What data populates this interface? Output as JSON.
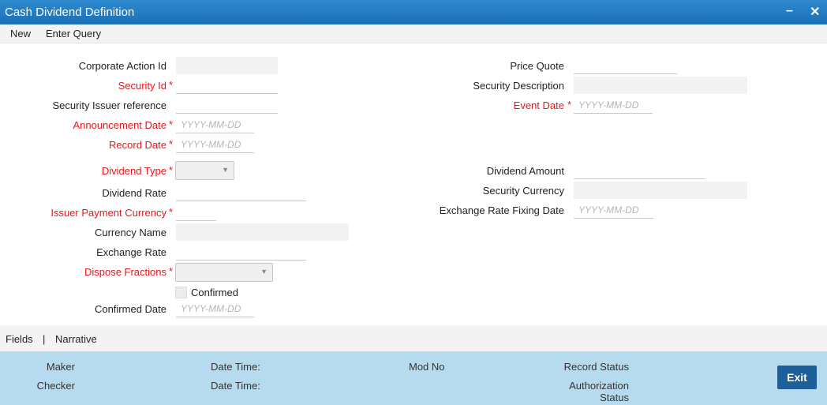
{
  "window": {
    "title": "Cash Dividend Definition",
    "minimize_icon": "minimize-icon",
    "close_icon": "close-icon"
  },
  "menu": {
    "new_label": "New",
    "enter_query_label": "Enter Query"
  },
  "form": {
    "corporate_action_id": {
      "label": "Corporate Action Id",
      "value": ""
    },
    "security_id": {
      "label": "Security Id",
      "value": ""
    },
    "security_issuer_reference": {
      "label": "Security Issuer reference",
      "value": ""
    },
    "announcement_date": {
      "label": "Announcement Date",
      "placeholder": "YYYY-MM-DD"
    },
    "record_date": {
      "label": "Record Date",
      "placeholder": "YYYY-MM-DD"
    },
    "dividend_type": {
      "label": "Dividend Type",
      "selected": ""
    },
    "dividend_rate": {
      "label": "Dividend Rate",
      "value": ""
    },
    "issuer_payment_currency": {
      "label": "Issuer Payment Currency",
      "value": ""
    },
    "currency_name": {
      "label": "Currency Name",
      "value": ""
    },
    "exchange_rate": {
      "label": "Exchange Rate",
      "value": ""
    },
    "dispose_fractions": {
      "label": "Dispose Fractions",
      "selected": ""
    },
    "confirmed": {
      "label": "Confirmed",
      "checked": false
    },
    "confirmed_date": {
      "label": "Confirmed Date",
      "placeholder": "YYYY-MM-DD"
    },
    "price_quote": {
      "label": "Price Quote",
      "value": ""
    },
    "security_description": {
      "label": "Security Description",
      "value": ""
    },
    "event_date": {
      "label": "Event Date",
      "placeholder": "YYYY-MM-DD"
    },
    "dividend_amount": {
      "label": "Dividend Amount",
      "value": ""
    },
    "security_currency": {
      "label": "Security Currency",
      "value": ""
    },
    "exchange_rate_fixing_date": {
      "label": "Exchange Rate Fixing Date",
      "placeholder": "YYYY-MM-DD"
    },
    "required_marker": "*"
  },
  "tabs": {
    "fields": "Fields",
    "separator": "|",
    "narrative": "Narrative"
  },
  "footer": {
    "maker": "Maker",
    "checker": "Checker",
    "date_time_1": "Date Time:",
    "date_time_2": "Date Time:",
    "mod_no": "Mod No",
    "record_status": "Record Status",
    "authorization": "Authorization",
    "status": "Status",
    "exit_label": "Exit"
  },
  "colors": {
    "title_bar": "#1a6fb5",
    "required": "#e8161b",
    "footer": "#b6dbef",
    "exit_button": "#1d5f9a"
  }
}
